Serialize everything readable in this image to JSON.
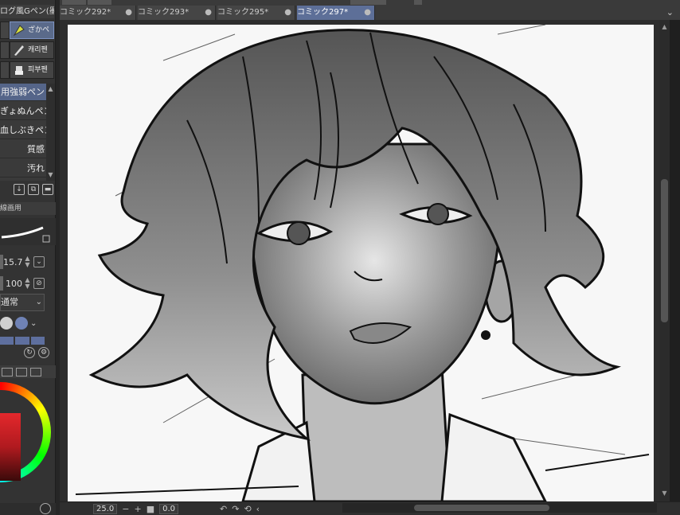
{
  "tool_panel": {
    "title": "ログ風Gペン(墨かす",
    "tools": [
      {
        "label": "ざかペ",
        "icon": "pen-nib-icon",
        "selected": true
      },
      {
        "label": "캐리펜",
        "icon": "pen-icon"
      },
      {
        "label": "피부펜",
        "icon": "brush-icon"
      }
    ],
    "subtools": [
      "用強弱ペン",
      "ぎょぬんペン",
      "血しぶきペン",
      "質感",
      "汚れ"
    ],
    "selected_subtool_index": 0,
    "prop_title": "線画用",
    "brush_size": "15.7",
    "opacity": "100",
    "blend_mode": "通常"
  },
  "tabs": [
    {
      "label": "コミック292*"
    },
    {
      "label": "コミック293*"
    },
    {
      "label": "コミック295*"
    },
    {
      "label": "コミック297*",
      "active": true
    }
  ],
  "status": {
    "zoom": "25.0",
    "angle": "0.0",
    "zoom_out": "−",
    "zoom_in": "+",
    "stop": "■"
  },
  "colors": {
    "accent": "#5d6f98",
    "main_color": "#e4282c"
  }
}
